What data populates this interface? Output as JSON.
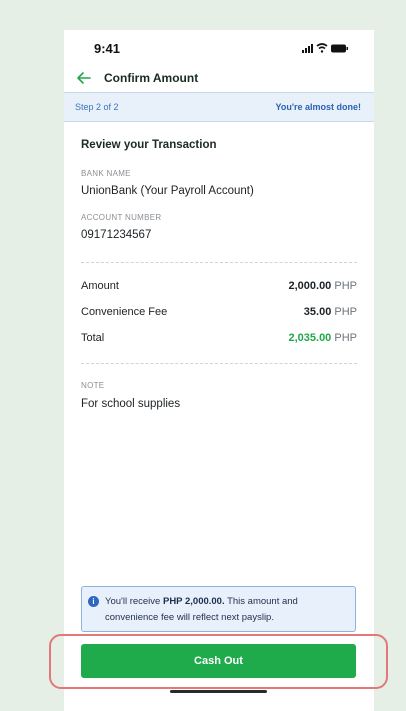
{
  "status_bar": {
    "time": "9:41"
  },
  "header": {
    "title": "Confirm Amount"
  },
  "stepper": {
    "step": "Step 2 of 2",
    "message": "You're almost done!"
  },
  "review": {
    "title": "Review your Transaction",
    "bank_label": "BANK NAME",
    "bank_value": "UnionBank (Your Payroll Account)",
    "account_label": "ACCOUNT NUMBER",
    "account_value": "09171234567"
  },
  "summary": {
    "currency": "PHP",
    "rows": [
      {
        "label": "Amount",
        "value": "2,000.00"
      },
      {
        "label": "Convenience Fee",
        "value": "35.00"
      },
      {
        "label": "Total",
        "value": "2,035.00"
      }
    ]
  },
  "note": {
    "label": "NOTE",
    "value": "For school supplies"
  },
  "notice": {
    "prefix": "You'll receive ",
    "amount": "PHP 2,000.00.",
    "suffix": " This amount and convenience fee will reflect next payslip."
  },
  "actions": {
    "cash_out_label": "Cash Out"
  },
  "colors": {
    "accent_green": "#1faa4c",
    "info_blue": "#2e67c2",
    "highlight_red": "#e27878"
  }
}
